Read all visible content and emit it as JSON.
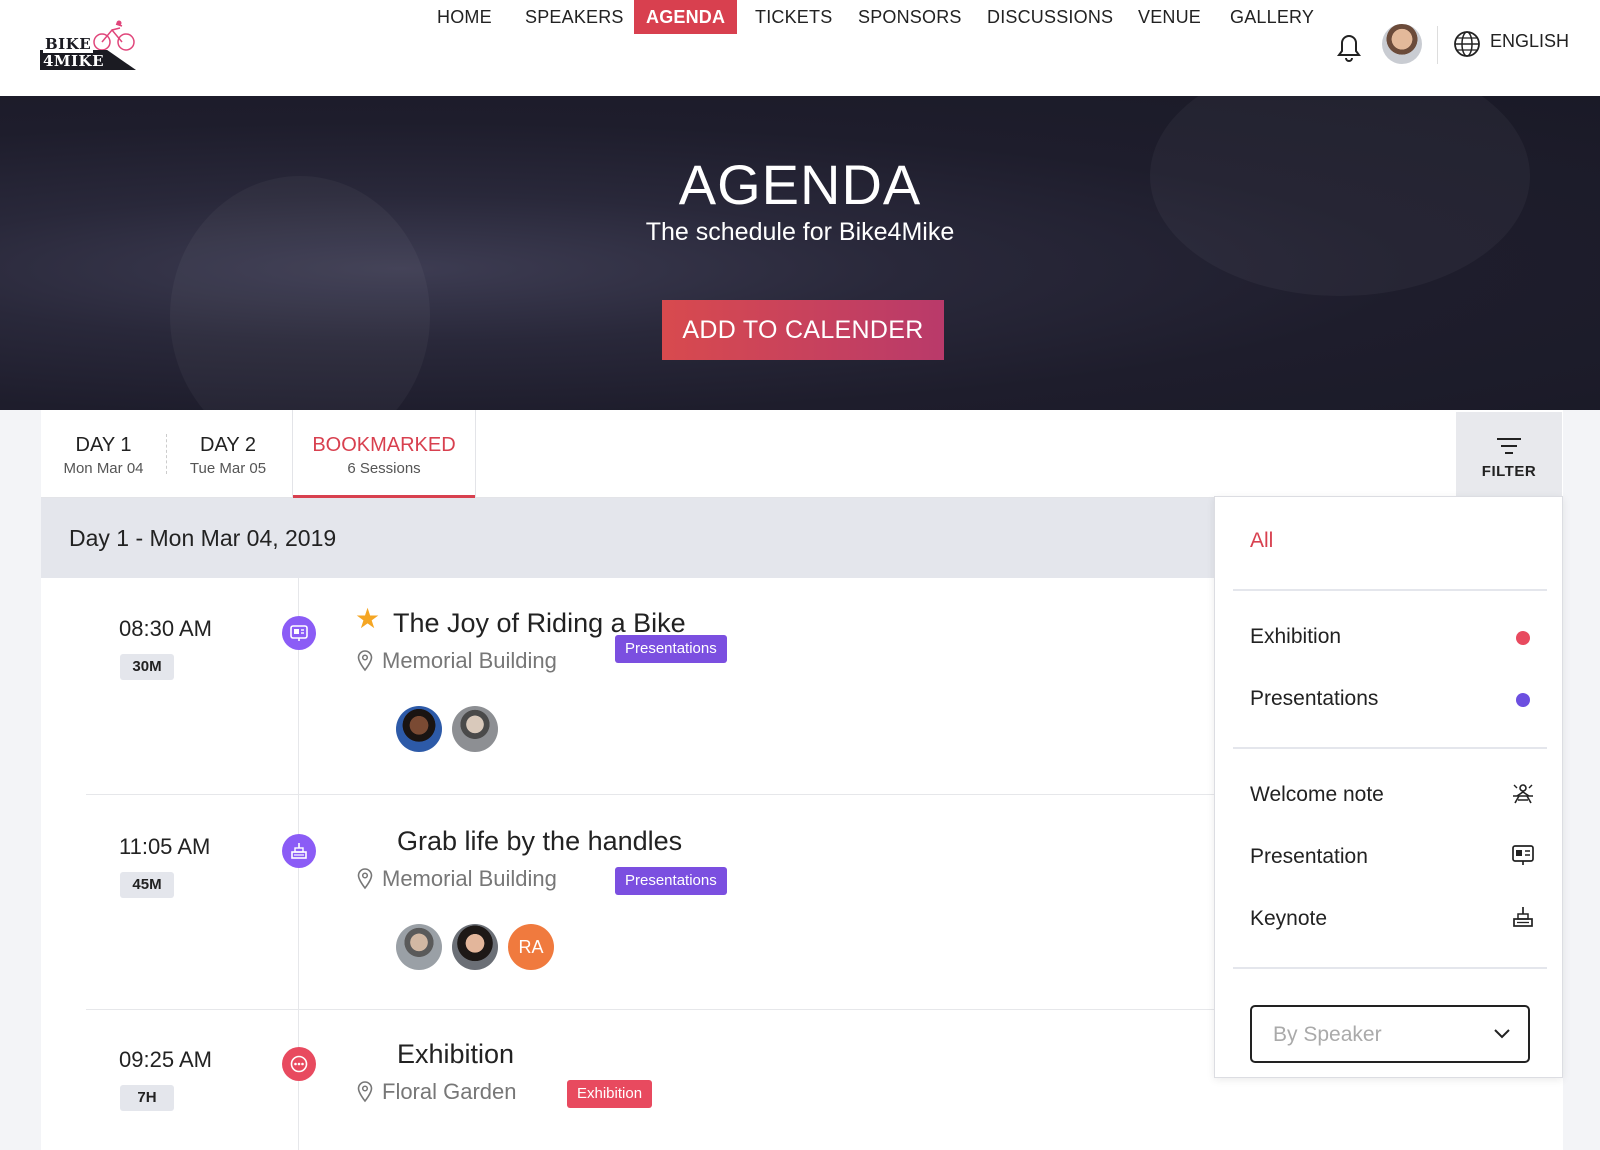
{
  "brand": {
    "logo_line1": "BIKE",
    "logo_line2": "4MIKE"
  },
  "nav": {
    "items": [
      "HOME",
      "SPEAKERS",
      "AGENDA",
      "TICKETS",
      "SPONSORS",
      "DISCUSSIONS",
      "VENUE",
      "GALLERY"
    ],
    "active": "AGENDA",
    "language": "ENGLISH"
  },
  "hero": {
    "title": "AGENDA",
    "subtitle": "The schedule for Bike4Mike",
    "cta": "ADD TO CALENDER"
  },
  "tabs": [
    {
      "title": "DAY 1",
      "sub": "Mon Mar 04"
    },
    {
      "title": "DAY 2",
      "sub": "Tue Mar 05"
    },
    {
      "title": "BOOKMARKED",
      "sub": "6 Sessions"
    }
  ],
  "active_tab": "BOOKMARKED",
  "filter": {
    "button_label": "FILTER",
    "all": "All",
    "categories": [
      {
        "label": "Exhibition",
        "color": "#e84a5f"
      },
      {
        "label": "Presentations",
        "color": "#6c4fe0"
      }
    ],
    "types": [
      {
        "label": "Welcome note",
        "icon": "welcome-note-icon"
      },
      {
        "label": "Presentation",
        "icon": "presentation-icon"
      },
      {
        "label": "Keynote",
        "icon": "keynote-icon"
      }
    ],
    "speaker_placeholder": "By Speaker"
  },
  "day_header": "Day 1 - Mon Mar 04, 2019",
  "sessions": [
    {
      "time": "08:30 AM",
      "duration": "30M",
      "type_icon": "presentation-icon",
      "type_color": "#8b5cf6",
      "bookmarked": true,
      "title": "The Joy of Riding a Bike",
      "location": "Memorial Building",
      "tag": "Presentations",
      "tag_color": "#7b4fe0",
      "speakers": [
        "photo",
        "photo"
      ]
    },
    {
      "time": "11:05 AM",
      "duration": "45M",
      "type_icon": "keynote-icon",
      "type_color": "#8b5cf6",
      "bookmarked": false,
      "title": "Grab life by the handles",
      "location": "Memorial Building",
      "tag": "Presentations",
      "tag_color": "#7b4fe0",
      "speakers": [
        "photo",
        "photo",
        "RA"
      ]
    },
    {
      "time": "09:25 AM",
      "duration": "7H",
      "type_icon": "exhibition-icon",
      "type_color": "#e84a5f",
      "bookmarked": false,
      "title": "Exhibition",
      "location": "Floral Garden",
      "tag": "Exhibition",
      "tag_color": "#e84a5f",
      "speakers": []
    }
  ]
}
